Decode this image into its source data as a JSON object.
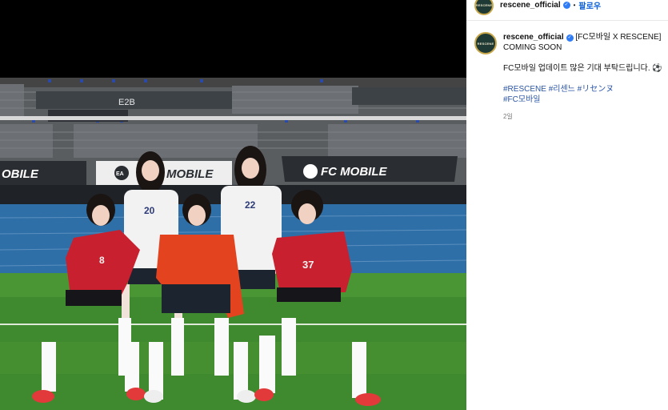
{
  "author": {
    "username": "rescene_official",
    "avatar_text": "RESCENE",
    "follow_label": "팔로우",
    "dot": "•"
  },
  "caption": {
    "line1": "[FC모바일 X RESCENE]",
    "line2": "COMING SOON",
    "line3": "FC모바일 업데이트 많은 기대 부탁드립니다. ⚽",
    "tags": [
      "#RESCENE",
      "#리센느",
      "#リセンヌ",
      "#FC모바일"
    ],
    "time": "2일"
  },
  "photo": {
    "section_sign": "E2B",
    "banners": [
      "OBILE",
      "MOBILE",
      "FC MOBILE"
    ],
    "ea_badge": "EA",
    "jersey_numbers": [
      "8",
      "20",
      "22",
      "37"
    ],
    "colors": {
      "pitch": "#3f8a2e",
      "track": "#2f6fa8",
      "red_kit": "#c8202e",
      "orange_kit": "#e4431f",
      "white_kit": "#f2f2f2"
    }
  }
}
